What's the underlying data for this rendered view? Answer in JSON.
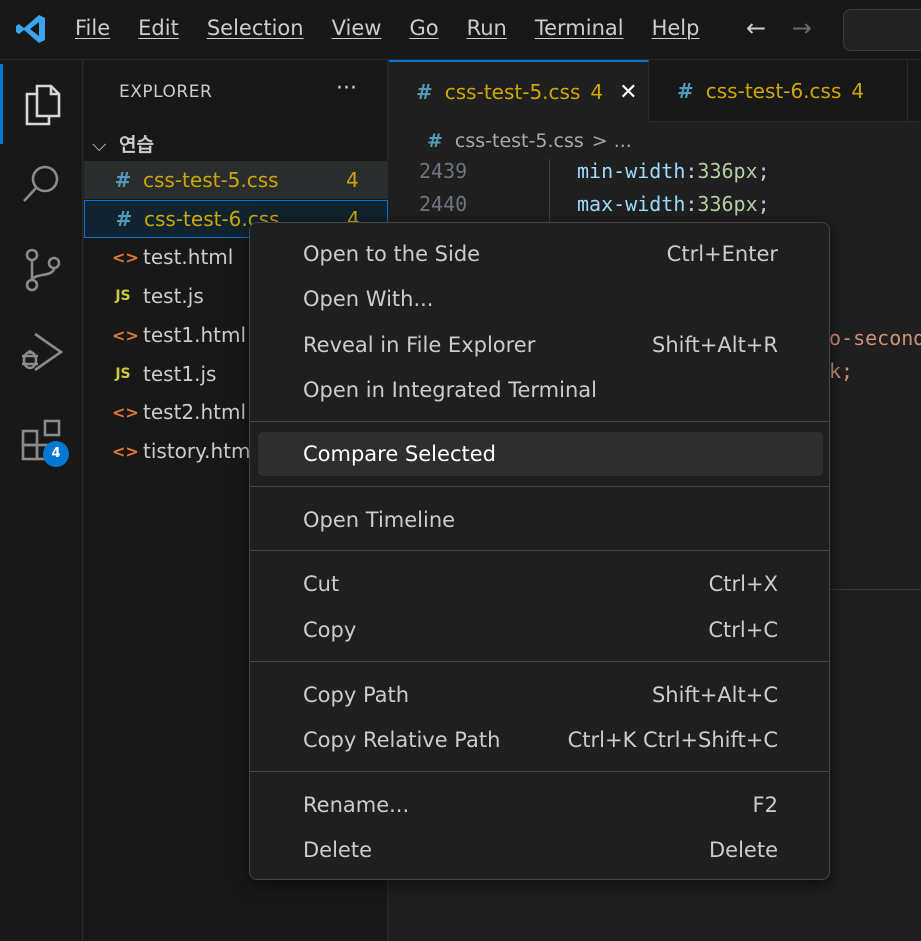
{
  "titlebar": {
    "menu": [
      "File",
      "Edit",
      "Selection",
      "View",
      "Go",
      "Run",
      "Terminal",
      "Help"
    ],
    "back_icon": "arrow-left",
    "forward_icon": "arrow-right"
  },
  "activitybar": {
    "items": [
      "explorer",
      "search",
      "source-control",
      "run-and-debug",
      "extensions"
    ],
    "extensions_badge": "4"
  },
  "sidebar": {
    "title": "EXPLORER",
    "more": "···",
    "folder": "연습",
    "files": [
      {
        "name": "css-test-5.css",
        "type": "css",
        "count": "4",
        "state": "selected"
      },
      {
        "name": "css-test-6.css",
        "type": "css",
        "count": "4",
        "state": "focused"
      },
      {
        "name": "test.html",
        "type": "html"
      },
      {
        "name": "test.js",
        "type": "js"
      },
      {
        "name": "test1.html",
        "type": "html"
      },
      {
        "name": "test1.js",
        "type": "js"
      },
      {
        "name": "test2.html",
        "type": "html"
      },
      {
        "name": "tistory.html",
        "type": "html"
      }
    ]
  },
  "tabs": [
    {
      "label": "css-test-5.css",
      "count": "4",
      "active": true
    },
    {
      "label": "css-test-6.css",
      "count": "4",
      "active": false
    }
  ],
  "breadcrumb": {
    "file": "css-test-5.css",
    "rest": "> ..."
  },
  "editor": {
    "lines": [
      {
        "number": "2439",
        "property": "min-width",
        "value": "336px"
      },
      {
        "number": "2440",
        "property": "max-width",
        "value": "336px"
      }
    ],
    "partial_1": "o-second",
    "partial_2": "k;"
  },
  "context_menu": {
    "groups": [
      [
        {
          "label": "Open to the Side",
          "shortcut": "Ctrl+Enter"
        },
        {
          "label": "Open With...",
          "shortcut": ""
        },
        {
          "label": "Reveal in File Explorer",
          "shortcut": "Shift+Alt+R"
        },
        {
          "label": "Open in Integrated Terminal",
          "shortcut": ""
        }
      ],
      [
        {
          "label": "Compare Selected",
          "shortcut": "",
          "highlighted": true
        }
      ],
      [
        {
          "label": "Open Timeline",
          "shortcut": ""
        }
      ],
      [
        {
          "label": "Cut",
          "shortcut": "Ctrl+X"
        },
        {
          "label": "Copy",
          "shortcut": "Ctrl+C"
        }
      ],
      [
        {
          "label": "Copy Path",
          "shortcut": "Shift+Alt+C"
        },
        {
          "label": "Copy Relative Path",
          "shortcut": "Ctrl+K Ctrl+Shift+C"
        }
      ],
      [
        {
          "label": "Rename...",
          "shortcut": "F2"
        },
        {
          "label": "Delete",
          "shortcut": "Delete"
        }
      ]
    ]
  },
  "colors": {
    "accent": "#0078d4",
    "warning": "#cca700",
    "css_icon": "#519aba",
    "html_icon": "#e37933",
    "js_icon": "#cbcb41"
  }
}
